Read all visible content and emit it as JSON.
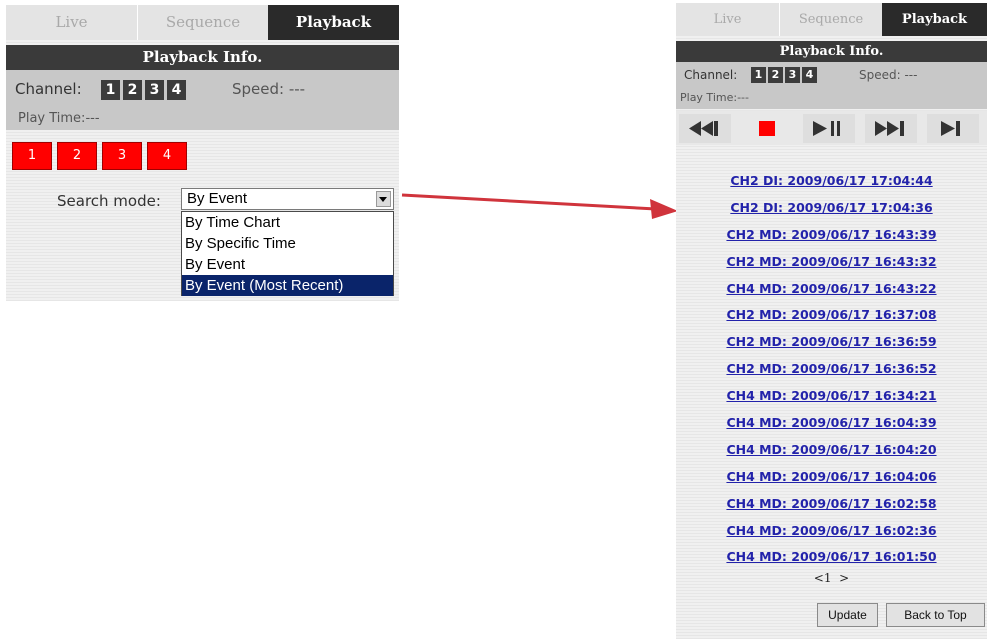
{
  "left_panel": {
    "tabs": [
      "Live",
      "Sequence",
      "Playback"
    ],
    "info_title": "Playback Info.",
    "channel_label": "Channel:",
    "channels": [
      "1",
      "2",
      "3",
      "4"
    ],
    "speed_text": "Speed: ---",
    "play_time_text": "Play Time:---",
    "red_buttons": [
      "1",
      "2",
      "3",
      "4"
    ],
    "search_mode_label": "Search mode:",
    "search_mode_value": "By Event",
    "dropdown_options": [
      "By Time Chart",
      "By Specific Time",
      "By Event",
      "By Event (Most Recent)"
    ],
    "highlighted_option": "By Event (Most Recent)"
  },
  "right_panel": {
    "tabs": [
      "Live",
      "Sequence",
      "Playback"
    ],
    "info_title": "Playback Info.",
    "channel_label": "Channel:",
    "channels": [
      "1",
      "2",
      "3",
      "4"
    ],
    "speed_text": "Speed: ---",
    "play_time_text": "Play Time:---",
    "controls": [
      "rewind-icon",
      "stop-icon",
      "play-pause-icon",
      "fast-forward-icon",
      "skip-to-end-icon"
    ],
    "events": [
      "CH2 DI: 2009/06/17 17:04:44",
      "CH2 DI: 2009/06/17 17:04:36",
      "CH2 MD: 2009/06/17 16:43:39",
      "CH2 MD: 2009/06/17 16:43:32",
      "CH4 MD: 2009/06/17 16:43:22",
      "CH2 MD: 2009/06/17 16:37:08",
      "CH2 MD: 2009/06/17 16:36:59",
      "CH2 MD: 2009/06/17 16:36:52",
      "CH4 MD: 2009/06/17 16:34:21",
      "CH4 MD: 2009/06/17 16:04:39",
      "CH4 MD: 2009/06/17 16:04:20",
      "CH4 MD: 2009/06/17 16:04:06",
      "CH4 MD: 2009/06/17 16:02:58",
      "CH4 MD: 2009/06/17 16:02:36",
      "CH4 MD: 2009/06/17 16:01:50"
    ],
    "pager_prev": "<1",
    "pager_next": ">",
    "update_label": "Update",
    "back_to_top_label": "Back to Top"
  },
  "colors": {
    "red_button": "#ff0000",
    "dark_bar": "#3a3a3a",
    "info_bg": "#c8c8c8",
    "link": "#2222aa",
    "selection": "#0a246a",
    "arrow": "#d0343c"
  }
}
